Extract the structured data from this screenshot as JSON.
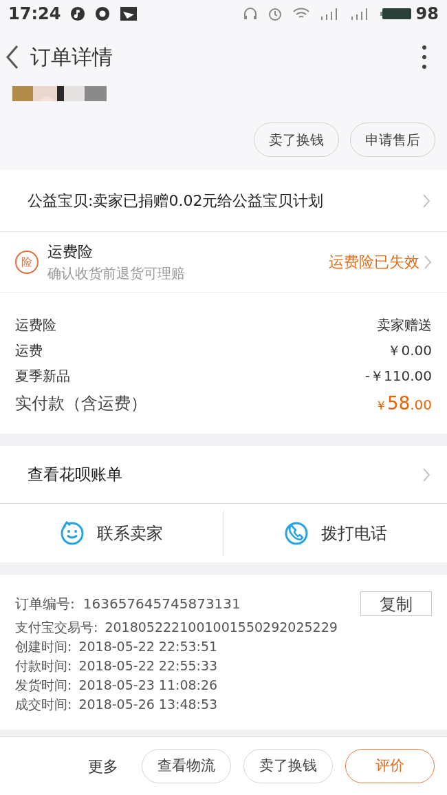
{
  "status_bar": {
    "time": "17:24",
    "battery": "98"
  },
  "nav": {
    "title": "订单详情"
  },
  "item_photo": {
    "kind": "picture"
  },
  "item_actions": [
    "卖了换钱",
    "申请售后"
  ],
  "charity": {
    "text": "公益宝贝:卖家已捐赠0.02元给公益宝贝计划"
  },
  "insurance": {
    "badge": "险",
    "title": "运费险",
    "subtitle": "确认收货前退货可理赔",
    "status": "运费险已失效"
  },
  "fees": [
    {
      "label": "运费险",
      "value": "卖家赠送"
    },
    {
      "label": "运费",
      "value": "￥0.00"
    },
    {
      "label": "夏季新品",
      "value": "-￥110.00"
    }
  ],
  "total": {
    "label": "实付款（含运费）",
    "currency": "￥",
    "integer": "58",
    "decimal": ".00"
  },
  "huabei": {
    "text": "查看花呗账单"
  },
  "contact": [
    {
      "kind": "chat",
      "label": "联系卖家"
    },
    {
      "kind": "phone",
      "label": "拨打电话"
    }
  ],
  "order_info": {
    "order_no_label": "订单编号:",
    "order_no": "163657645745873131",
    "copy": "复制",
    "rows": [
      {
        "label": "支付宝交易号:",
        "value": "2018052221001001550292025229"
      },
      {
        "label": "创建时间:",
        "value": "2018-05-22 22:53:51"
      },
      {
        "label": "付款时间:",
        "value": "2018-05-22 22:55:33"
      },
      {
        "label": "发货时间:",
        "value": "2018-05-23 11:08:26"
      },
      {
        "label": "成交时间:",
        "value": "2018-05-26 13:48:53"
      }
    ]
  },
  "bottom_bar": {
    "more": "更多",
    "buttons": [
      {
        "label": "查看物流",
        "primary": false
      },
      {
        "label": "卖了换钱",
        "primary": false
      },
      {
        "label": "评价",
        "primary": true
      }
    ]
  }
}
